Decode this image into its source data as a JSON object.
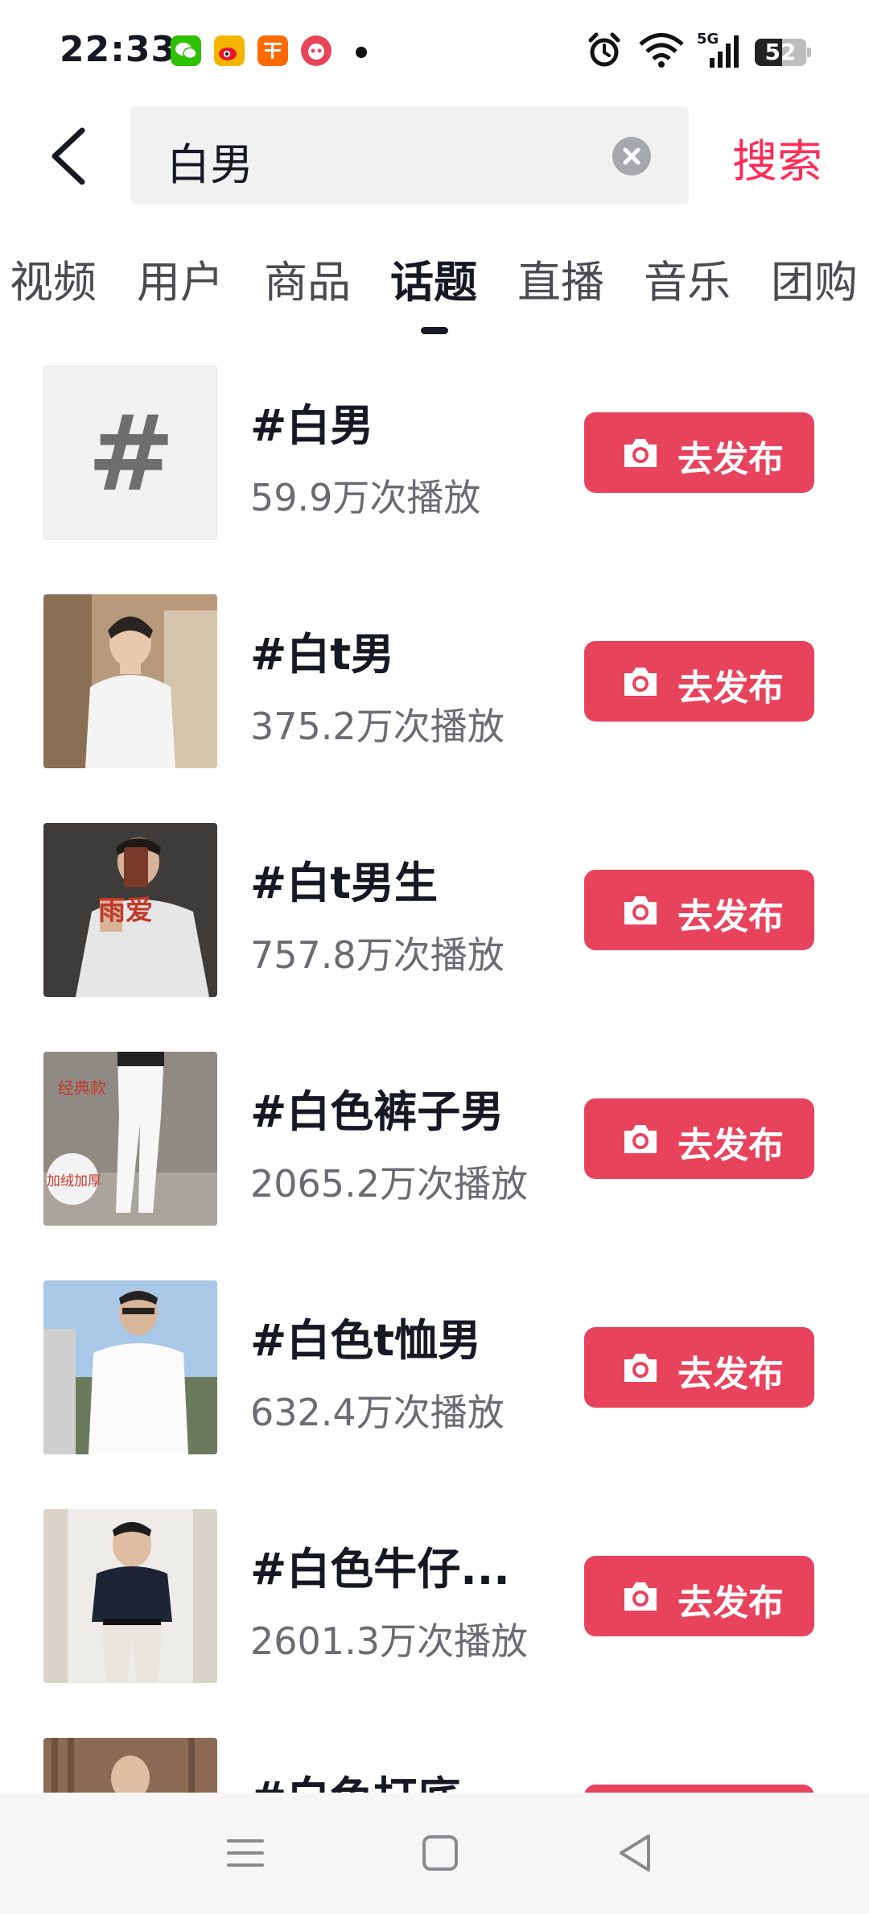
{
  "status_bar": {
    "time": "22:33",
    "app_icons": [
      {
        "name": "wechat-icon",
        "color": "#2dc100",
        "glyph": "✆"
      },
      {
        "name": "weibo-icon",
        "color": "#f5a623",
        "glyph": "微"
      },
      {
        "name": "taobao-icon",
        "color": "#ff6a00",
        "glyph": "淘"
      },
      {
        "name": "app-notification-icon",
        "color": "#e8455a",
        "glyph": "◉"
      }
    ],
    "network_label": "5G",
    "battery": "52"
  },
  "search": {
    "query": "白男",
    "submit_label": "搜索"
  },
  "tabs": [
    "视频",
    "用户",
    "商品",
    "话题",
    "直播",
    "音乐",
    "团购"
  ],
  "active_tab": "话题",
  "topics": [
    {
      "name": "#白男",
      "plays": "59.9万次播放",
      "thumb": "hash"
    },
    {
      "name": "#白t男",
      "plays": "375.2万次播放",
      "thumb": "photo"
    },
    {
      "name": "#白t男生",
      "plays": "757.8万次播放",
      "thumb": "photo"
    },
    {
      "name": "#白色裤子男",
      "plays": "2065.2万次播放",
      "thumb": "photo"
    },
    {
      "name": "#白色t恤男",
      "plays": "632.4万次播放",
      "thumb": "photo"
    },
    {
      "name": "#白色牛仔...",
      "plays": "2601.3万次播放",
      "thumb": "photo"
    },
    {
      "name": "#白色打底",
      "plays": "",
      "thumb": "photo"
    }
  ],
  "thumb_overlays": {
    "topic_2": "雨爱",
    "topic_3_badge": "加绒加厚",
    "topic_3_label": "经典款"
  },
  "publish_label": "去发布",
  "colors": {
    "accent": "#fe2c55",
    "button": "#e8435d"
  }
}
